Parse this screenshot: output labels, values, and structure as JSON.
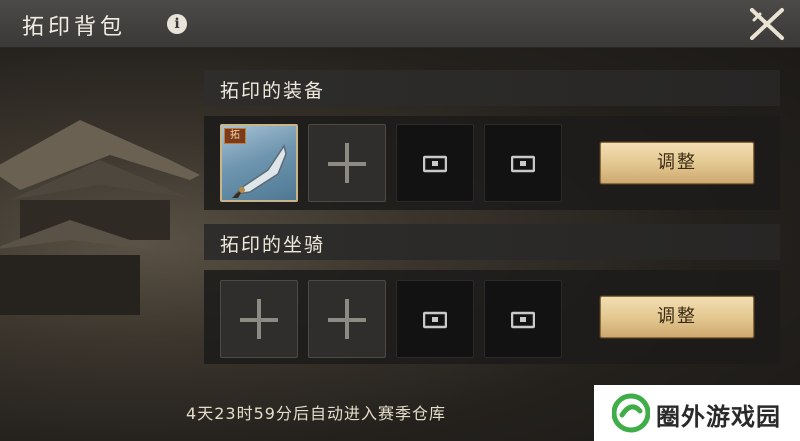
{
  "header": {
    "title": "拓印背包",
    "info_icon": "info-icon",
    "close_icon": "close-icon"
  },
  "sections": [
    {
      "title": "拓印的装备",
      "slots": [
        {
          "type": "item",
          "tag": "拓",
          "icon": "blade-icon"
        },
        {
          "type": "empty",
          "icon": "plus-icon"
        },
        {
          "type": "locked",
          "icon": "lock-icon"
        },
        {
          "type": "locked",
          "icon": "lock-icon"
        }
      ],
      "button": "调整"
    },
    {
      "title": "拓印的坐骑",
      "slots": [
        {
          "type": "empty",
          "icon": "plus-icon"
        },
        {
          "type": "empty",
          "icon": "plus-icon"
        },
        {
          "type": "locked",
          "icon": "lock-icon"
        },
        {
          "type": "locked",
          "icon": "lock-icon"
        }
      ],
      "button": "调整"
    }
  ],
  "footer": {
    "countdown": "4天23时59分后自动进入赛季仓库"
  },
  "watermark": {
    "text": "圈外游戏园"
  },
  "colors": {
    "accent_button": "#e2c68e",
    "header_bg": "#3a3937",
    "panel_bg": "#1c1b1a"
  }
}
